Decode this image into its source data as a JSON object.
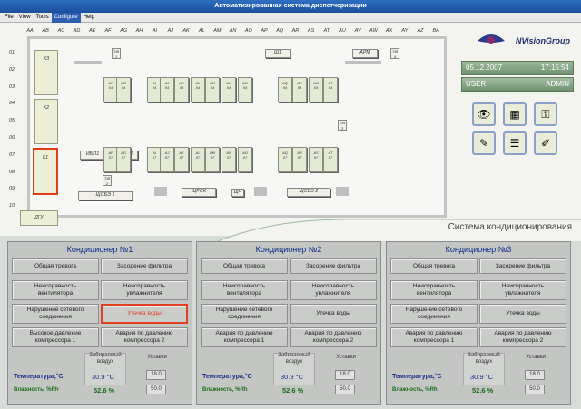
{
  "window": {
    "title": "Автоматизированная система диспетчеризации"
  },
  "menu": [
    {
      "label": "File"
    },
    {
      "label": "View"
    },
    {
      "label": "Tools"
    },
    {
      "label": "Configure"
    },
    {
      "label": "Help"
    }
  ],
  "plan": {
    "columns": [
      "AA",
      "AB",
      "AC",
      "AD",
      "AE",
      "AF",
      "AG",
      "AH",
      "AI",
      "AJ",
      "AK",
      "AL",
      "AM",
      "AN",
      "AO",
      "AP",
      "AQ",
      "AR",
      "AS",
      "AT",
      "AU",
      "AV",
      "AW",
      "AX",
      "AY",
      "AZ",
      "BA"
    ],
    "rows": [
      "01",
      "02",
      "03",
      "04",
      "05",
      "06",
      "07",
      "08",
      "09",
      "10"
    ],
    "zones": {
      "k3": "K3",
      "k2": "K2",
      "k1": "K1"
    },
    "tags": {
      "t1": "Т/В\n1",
      "sh1": "Ш1",
      "arm": "АРМ",
      "t4": "Т/В\n4",
      "t3": "Т/В\n3",
      "yep1": "ИБП1",
      "yep2": "ИБП2",
      "t2": "Т/В\n2",
      "shsbe1": "ЩСБЭ 1",
      "shrsk": "ЩРСК",
      "shch": "ЩЧ",
      "shsbe2": "ЩСБЭ 2",
      "dgu": "ДГУ"
    },
    "units_top": [
      "AF\n04",
      "AG\n04",
      "AI\n04",
      "AJ\n04",
      "AK\n04",
      "AL\n04",
      "AM\n04",
      "AN\n04",
      "AO\n04",
      "AQ\n04",
      "AR\n04",
      "AS\n04",
      "AT\n04"
    ],
    "units_bottom": [
      "AF\n07",
      "AG\n07",
      "AI\n07",
      "AJ\n07",
      "AK\n07",
      "AL\n07",
      "AM\n07",
      "AN\n07",
      "AO\n07",
      "AQ\n07",
      "AR\n07",
      "AS\n07",
      "AT\n07"
    ]
  },
  "header": {
    "brand": "NVisionGroup",
    "date": "05.12.2007",
    "time": "17:15:54",
    "user_label": "USER",
    "user_value": "ADMIN"
  },
  "section_title": "Система кондиционирования",
  "icons": [
    "eye-icon",
    "panel-icon",
    "key-icon",
    "wrench-icon",
    "list-icon",
    "pencil-icon"
  ],
  "conditioners": [
    {
      "title": "Кондиционер №1",
      "buttons": [
        "Общая тревога",
        "Засорение фильтра",
        "Неисправность\nвентилятора",
        "Неисправность\nувлажнителя",
        "Нарушение сетевого\nсоединения",
        "Утечка воды",
        "Высокое давление\nкомпрессора 1",
        "Авария по давлению\nкомпрессора 2"
      ],
      "alarm_index": 5,
      "air_label": "Забираемый\nвоздух",
      "set_label": "Уставки",
      "temp_label": "Температура,°C",
      "hum_label": "Влажность, %Rh",
      "temp": "30.9 °C",
      "hum": "52.6 %",
      "temp_set": "18.0",
      "hum_set": "50.0"
    },
    {
      "title": "Кондиционер №2",
      "buttons": [
        "Общая тревога",
        "Засорение фильтра",
        "Неисправность\nвентилятора",
        "Неисправность\nувлажнителя",
        "Нарушение сетевого\nсоединения",
        "Утечка воды",
        "Авария по давлению\nкомпрессора 1",
        "Авария по давлению\nкомпрессора 2"
      ],
      "alarm_index": -1,
      "air_label": "Забираемый\nвоздух",
      "set_label": "Уставки",
      "temp_label": "Температура,°C",
      "hum_label": "Влажность, %Rh",
      "temp": "30.9 °C",
      "hum": "52.6 %",
      "temp_set": "18.0",
      "hum_set": "50.0"
    },
    {
      "title": "Кондиционер №3",
      "buttons": [
        "Общая тревога",
        "Засорение фильтра",
        "Неисправность\nвентилятора",
        "Неисправность\nувлажнителя",
        "Нарушение сетевого\nсоединения",
        "Утечка воды",
        "Авария по давлению\nкомпрессора 1",
        "Авария по давлению\nкомпрессора 2"
      ],
      "alarm_index": -1,
      "air_label": "Забираемый\nвоздух",
      "set_label": "Уставки",
      "temp_label": "Температура,°C",
      "hum_label": "Влажность, %Rh",
      "temp": "30.9 °C",
      "hum": "52.6 %",
      "temp_set": "18.0",
      "hum_set": "50.0"
    }
  ]
}
